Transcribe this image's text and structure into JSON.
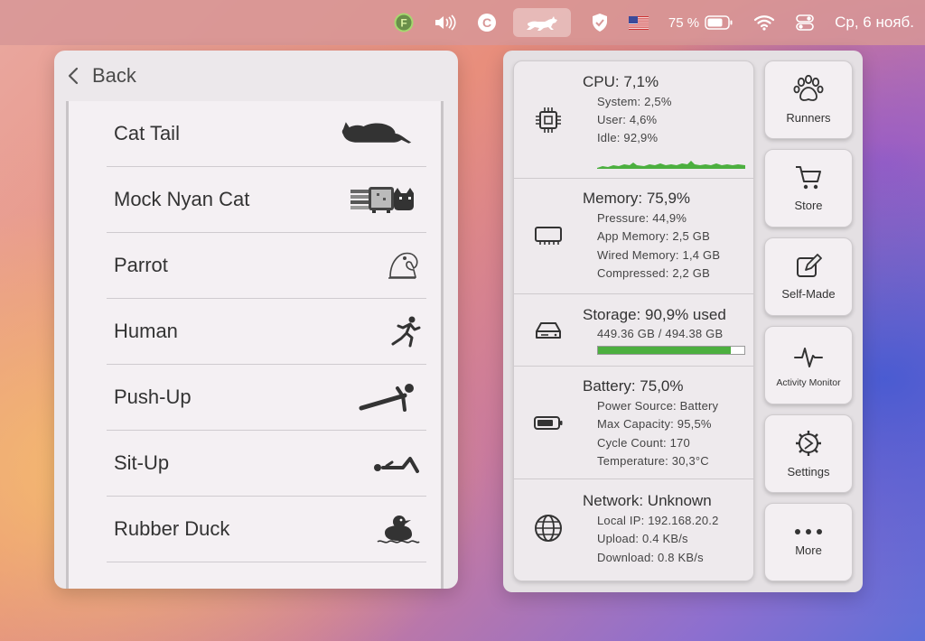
{
  "menubar": {
    "battery_percent": "75 %",
    "date": "Ср, 6 нояб."
  },
  "runner_panel": {
    "back_label": "Back",
    "items": [
      {
        "label": "Cat Tail"
      },
      {
        "label": "Mock Nyan Cat"
      },
      {
        "label": "Parrot"
      },
      {
        "label": "Human"
      },
      {
        "label": "Push-Up"
      },
      {
        "label": "Sit-Up"
      },
      {
        "label": "Rubber Duck"
      }
    ]
  },
  "stats": {
    "cpu": {
      "title": "CPU:  7,1%",
      "lines": [
        "System:  2,5%",
        "User:  4,6%",
        "Idle:  92,9%"
      ]
    },
    "memory": {
      "title": "Memory: 75,9%",
      "lines": [
        "Pressure: 44,9%",
        "App Memory:  2,5 GB",
        "Wired Memory:  1,4 GB",
        "Compressed:  2,2 GB"
      ]
    },
    "storage": {
      "title": "Storage: 90,9% used",
      "line": "449.36 GB / 494.38 GB",
      "used_fraction": 0.909
    },
    "battery": {
      "title": "Battery:  75,0%",
      "lines": [
        "Power Source: Battery",
        "Max Capacity:  95,5%",
        "Cycle Count:  170",
        "Temperature:  30,3°C"
      ]
    },
    "network": {
      "title": "Network: Unknown",
      "lines": [
        "Local IP: 192.168.20.2",
        "Upload:    0.4 KB/s",
        "Download:    0.8 KB/s"
      ]
    }
  },
  "side_buttons": {
    "runners": "Runners",
    "store": "Store",
    "self_made": "Self-Made",
    "activity_monitor": "Activity Monitor",
    "settings": "Settings",
    "more": "More"
  },
  "colors": {
    "accent_green": "#4caf3f"
  }
}
